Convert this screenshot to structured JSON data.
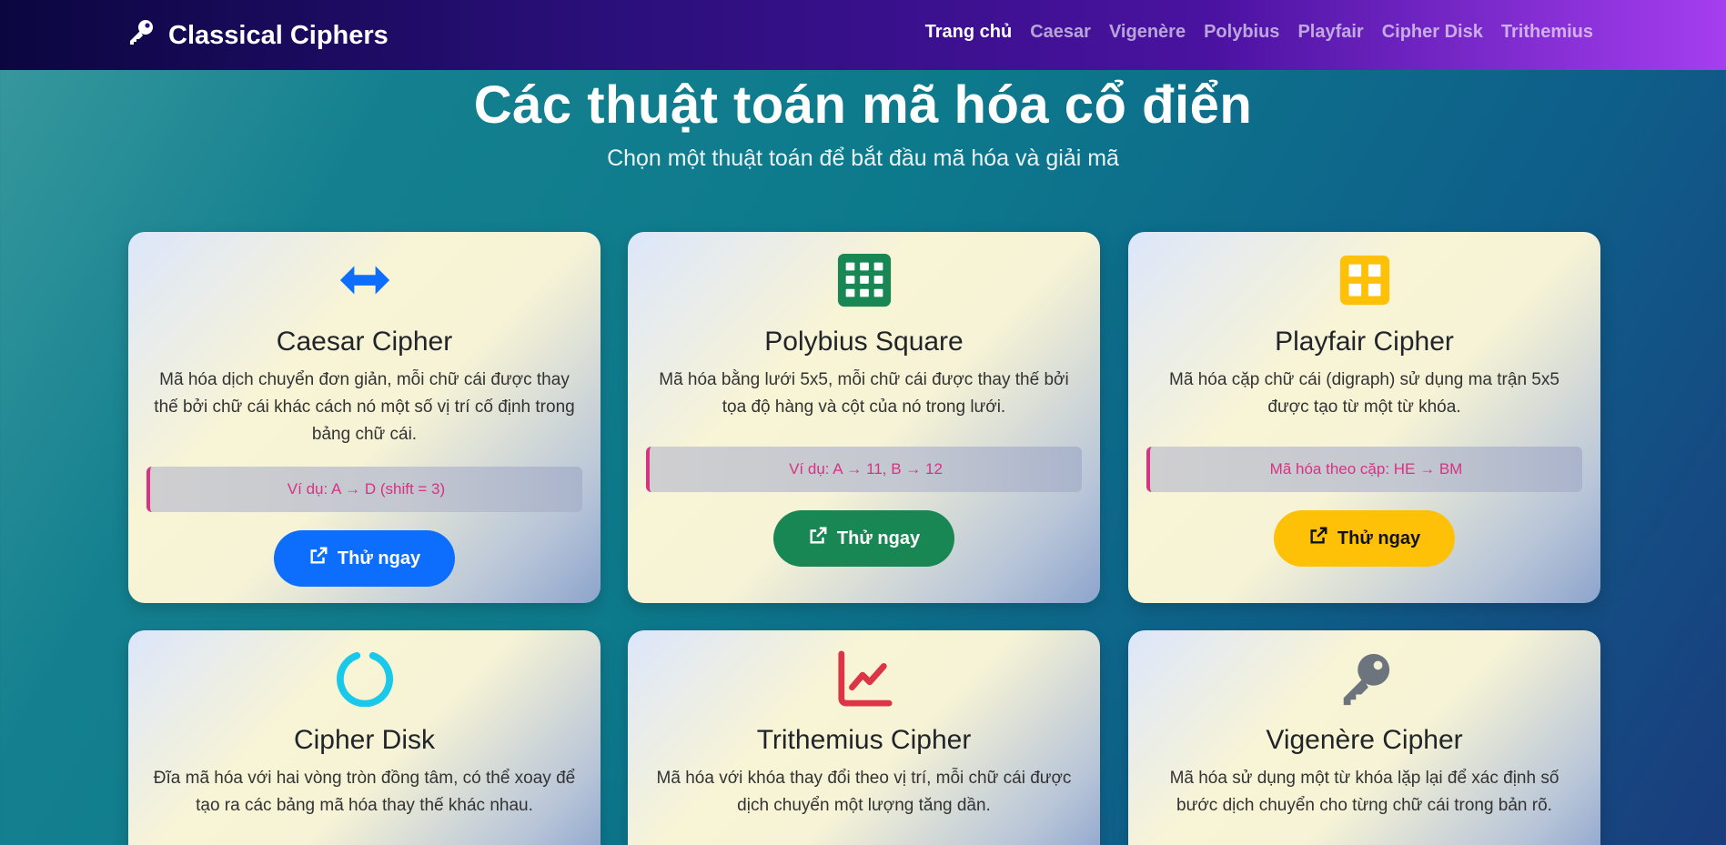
{
  "nav": {
    "brand": "Classical Ciphers",
    "links": [
      "Trang chủ",
      "Caesar",
      "Vigenère",
      "Polybius",
      "Playfair",
      "Cipher Disk",
      "Trithemius"
    ]
  },
  "hero": {
    "title": "Các thuật toán mã hóa cổ điển",
    "subtitle": "Chọn một thuật toán để bắt đầu mã hóa và giải mã"
  },
  "colors": {
    "nav_start": "#0b0640",
    "nav_end": "#a53ef0",
    "blue": "#0d6efd",
    "green": "#198754",
    "yellow": "#ffc107",
    "cyan": "#1ac8ea",
    "red": "#dc3545",
    "gray": "#6c757d",
    "example_text": "#d63384"
  },
  "cards": [
    {
      "title": "Caesar Cipher",
      "icon": "arrows-horizontal-icon",
      "description": "Mã hóa dịch chuyển đơn giản, mỗi chữ cái được thay thế bởi chữ cái khác cách nó một số vị trí cố định trong bảng chữ cái.",
      "example": "Ví dụ: A → D (shift = 3)",
      "button": "Thử ngay"
    },
    {
      "title": "Polybius Square",
      "icon": "grid-3x3-icon",
      "description": "Mã hóa bằng lưới 5x5, mỗi chữ cái được thay thế bởi tọa độ hàng và cột của nó trong lưới.",
      "example": "Ví dụ: A → 11, B → 12",
      "button": "Thử ngay"
    },
    {
      "title": "Playfair Cipher",
      "icon": "grid-2x2-icon",
      "description": "Mã hóa cặp chữ cái (digraph) sử dụng ma trận 5x5 được tạo từ một từ khóa.",
      "example": "Mã hóa theo cặp: HE → BM",
      "button": "Thử ngay"
    },
    {
      "title": "Cipher Disk",
      "icon": "circle-notch-icon",
      "description": "Đĩa mã hóa với hai vòng tròn đồng tâm, có thể xoay để tạo ra các bảng mã hóa thay thế khác nhau."
    },
    {
      "title": "Trithemius Cipher",
      "icon": "chart-line-icon",
      "description": "Mã hóa với khóa thay đổi theo vị trí, mỗi chữ cái được dịch chuyển một lượng tăng dần."
    },
    {
      "title": "Vigenère Cipher",
      "icon": "key-icon",
      "description": "Mã hóa sử dụng một từ khóa lặp lại để xác định số bước dịch chuyển cho từng chữ cái trong bản rõ."
    }
  ]
}
